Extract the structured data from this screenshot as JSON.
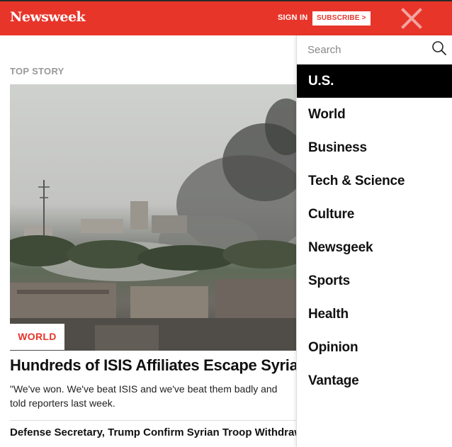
{
  "header": {
    "logo": "Newsweek",
    "sign_in": "SIGN IN",
    "subscribe": "SUBSCRIBE >",
    "accent_color": "#e8352a"
  },
  "main": {
    "kicker": "TOP STORY",
    "category": "WORLD",
    "headline": "Hundreds of ISIS Affiliates Escape Syrian I",
    "dek": "\"We've won. We've beat ISIS and we've beat them badly and\ntold reporters last week.",
    "related_headline": "Defense Secretary, Trump Confirm Syrian Troop Withdraw"
  },
  "menu": {
    "search_placeholder": "Search",
    "items": [
      {
        "label": "U.S.",
        "active": true
      },
      {
        "label": "World"
      },
      {
        "label": "Business"
      },
      {
        "label": "Tech & Science"
      },
      {
        "label": "Culture"
      },
      {
        "label": "Newsgeek"
      },
      {
        "label": "Sports"
      },
      {
        "label": "Health"
      },
      {
        "label": "Opinion"
      },
      {
        "label": "Vantage"
      }
    ]
  },
  "icons": [
    "search-icon",
    "close-icon"
  ]
}
